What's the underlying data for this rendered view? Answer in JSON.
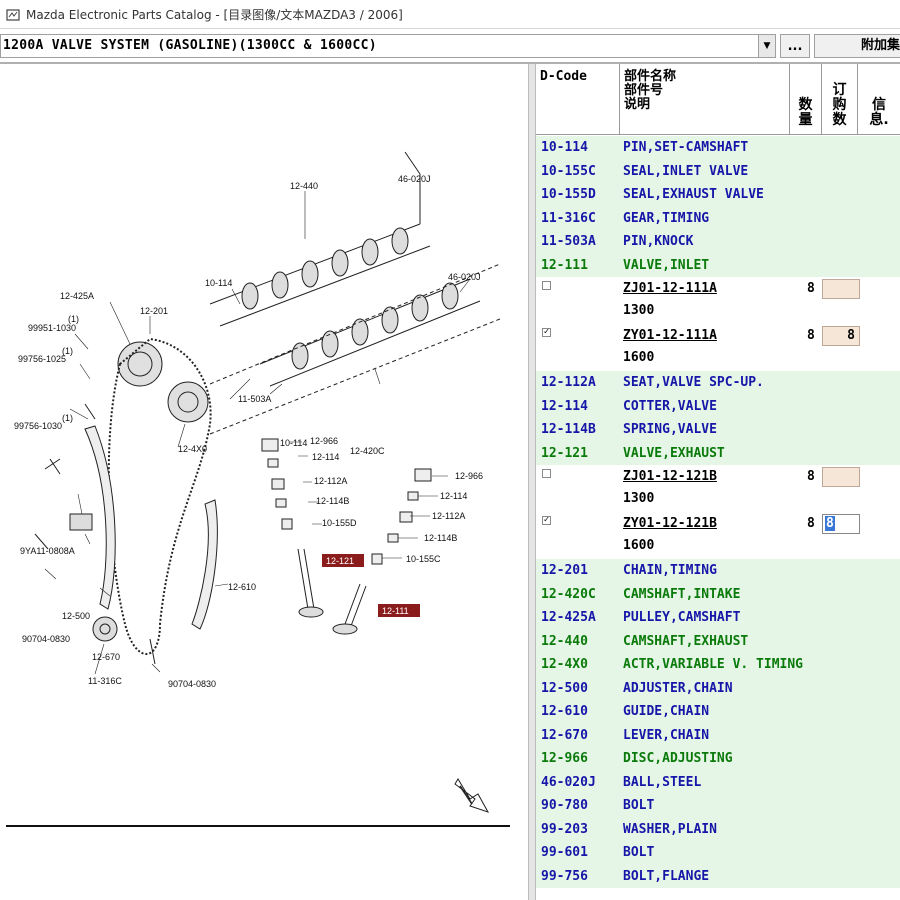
{
  "window": {
    "title": "Mazda Electronic Parts Catalog - [目录图像/文本MAZDA3 / 2006]"
  },
  "toolbar": {
    "section_value": "1200A  VALVE SYSTEM (GASOLINE)(1300CC & 1600CC)",
    "ellipsis_label": "...",
    "extra_label": "附加集"
  },
  "table": {
    "headers": {
      "code": "D-Code",
      "name_lines": [
        "部件名称",
        "部件号",
        "说明"
      ],
      "qty": "数量",
      "order": "订购数",
      "info": "信息."
    },
    "rows": [
      {
        "code": "10-114",
        "name": "PIN,SET-CAMSHAFT",
        "style": "green blue"
      },
      {
        "code": "10-155C",
        "name": "SEAL,INLET VALVE",
        "style": "green blue"
      },
      {
        "code": "10-155D",
        "name": "SEAL,EXHAUST VALVE",
        "style": "green blue"
      },
      {
        "code": "11-316C",
        "name": "GEAR,TIMING",
        "style": "green blue"
      },
      {
        "code": "11-503A",
        "name": "PIN,KNOCK",
        "style": "green blue"
      },
      {
        "code": "12-111",
        "name": "VALVE,INLET",
        "style": "green darkgreen"
      },
      {
        "code": "12-112A",
        "name": "SEAT,VALVE SPC-UP.",
        "style": "green blue"
      },
      {
        "code": "12-114",
        "name": "COTTER,VALVE",
        "style": "green blue"
      },
      {
        "code": "12-114B",
        "name": "SPRING,VALVE",
        "style": "green blue"
      },
      {
        "code": "12-121",
        "name": "VALVE,EXHAUST",
        "style": "green darkgreen"
      },
      {
        "code": "12-201",
        "name": "CHAIN,TIMING",
        "style": "green blue"
      },
      {
        "code": "12-420C",
        "name": "CAMSHAFT,INTAKE",
        "style": "green darkgreen"
      },
      {
        "code": "12-425A",
        "name": "PULLEY,CAMSHAFT",
        "style": "green blue"
      },
      {
        "code": "12-440",
        "name": "CAMSHAFT,EXHAUST",
        "style": "green darkgreen"
      },
      {
        "code": "12-4X0",
        "name": "ACTR,VARIABLE V. TIMING",
        "style": "green darkgreen"
      },
      {
        "code": "12-500",
        "name": "ADJUSTER,CHAIN",
        "style": "green blue"
      },
      {
        "code": "12-610",
        "name": "GUIDE,CHAIN",
        "style": "green blue"
      },
      {
        "code": "12-670",
        "name": "LEVER,CHAIN",
        "style": "green blue"
      },
      {
        "code": "12-966",
        "name": "DISC,ADJUSTING",
        "style": "green darkgreen"
      },
      {
        "code": "46-020J",
        "name": "BALL,STEEL",
        "style": "green blue"
      },
      {
        "code": "90-780",
        "name": "BOLT",
        "style": "green blue"
      },
      {
        "code": "99-203",
        "name": "WASHER,PLAIN",
        "style": "green blue"
      },
      {
        "code": "99-601",
        "name": "BOLT",
        "style": "green blue"
      },
      {
        "code": "99-756",
        "name": "BOLT,FLANGE",
        "style": "green blue"
      }
    ],
    "subparts": {
      "12-111": [
        {
          "part_no": "ZJ01-12-111A",
          "cc": "1300",
          "qty": "8",
          "order": "",
          "checked": false
        },
        {
          "part_no": "ZY01-12-111A",
          "cc": "1600",
          "qty": "8",
          "order": "8",
          "checked": true
        }
      ],
      "12-121": [
        {
          "part_no": "ZJ01-12-121B",
          "cc": "1300",
          "qty": "8",
          "order": "",
          "checked": false
        },
        {
          "part_no": "ZY01-12-121B",
          "cc": "1600",
          "qty": "8",
          "order": "8",
          "checked": true,
          "active": true
        }
      ]
    }
  },
  "diagram": {
    "labels": [
      "12-440",
      "46-020J",
      "10-114",
      "46-020J",
      "12-425A",
      "12-201",
      "99951-1030",
      "(1)",
      "99756-1025",
      "(1)",
      "99756-1030",
      "(1)",
      "10-114",
      "11-503A",
      "12-420C",
      "12-4X0",
      "9YA11-0808A",
      "12-966",
      "12-114",
      "12-112A",
      "12-114B",
      "10-155D",
      "12-966",
      "12-114",
      "12-112A",
      "12-114B",
      "10-155C",
      "12-500",
      "90704-0830",
      "12-610",
      "12-670",
      "11-316C",
      "90704-0830"
    ],
    "highlight_labels": [
      "12-121",
      "12-111"
    ]
  }
}
